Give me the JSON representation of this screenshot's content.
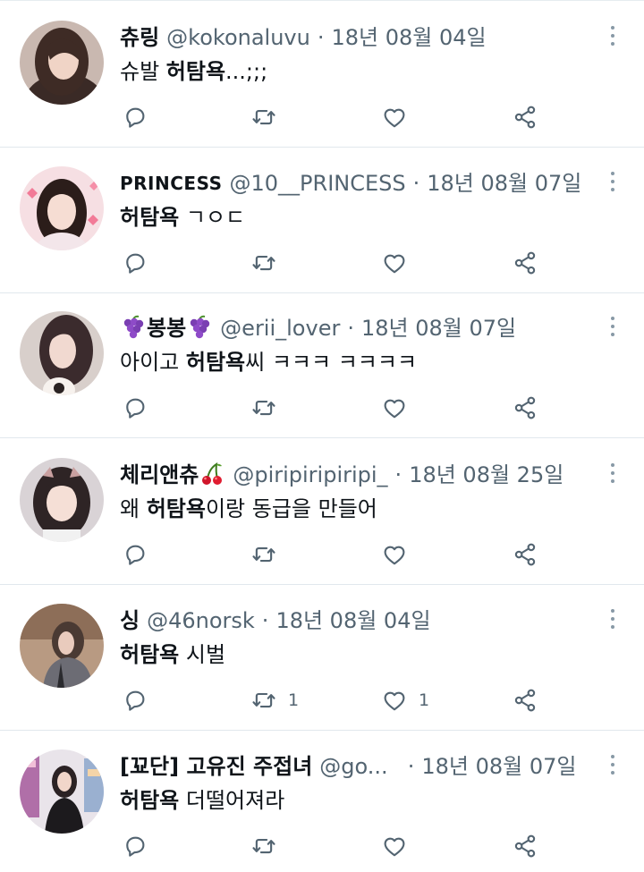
{
  "tweets": [
    {
      "name_pre": "츄링",
      "name_post": "",
      "name_emoji_pre": "",
      "name_emoji_post": "",
      "handle": "@kokonaluvu",
      "separator": "·",
      "date": "18년 08월 04일",
      "text_before": "슈발 ",
      "text_bold": "허탐욕",
      "text_after": "...;;;",
      "reply_count": "",
      "retweet_count": "",
      "like_count": ""
    },
    {
      "name_pre": "PRINCESS",
      "name_post": "",
      "name_emoji_pre": "",
      "name_emoji_post": "",
      "handle": "@10__PRINCESS",
      "separator": "·",
      "date": "18년 08월 07일",
      "text_before": "",
      "text_bold": "허탐욕",
      "text_after": " ㄱㅇㄷ",
      "reply_count": "",
      "retweet_count": "",
      "like_count": ""
    },
    {
      "name_pre": "",
      "name_post": "봉봉",
      "name_emoji_pre": "grapes",
      "name_emoji_post": "grapes",
      "handle": "@erii_lover",
      "separator": "·",
      "date": "18년 08월 07일",
      "text_before": "아이고 ",
      "text_bold": "허탐욕",
      "text_after": "씨 ㅋㅋㅋ ㅋㅋㅋㅋ",
      "reply_count": "",
      "retweet_count": "",
      "like_count": ""
    },
    {
      "name_pre": "체리앤츄",
      "name_post": "",
      "name_emoji_pre": "",
      "name_emoji_post": "cherries",
      "handle": "@piripiripiripi_",
      "separator": "·",
      "date": "18년 08월 25일",
      "text_before": "왜 ",
      "text_bold": "허탐욕",
      "text_after": "이랑 동급을 만들어",
      "reply_count": "",
      "retweet_count": "",
      "like_count": ""
    },
    {
      "name_pre": "싱",
      "name_post": "",
      "name_emoji_pre": "",
      "name_emoji_post": "",
      "handle": "@46norsk",
      "separator": "·",
      "date": "18년 08월 04일",
      "text_before": "",
      "text_bold": "허탐욕",
      "text_after": " 시벌",
      "reply_count": "",
      "retweet_count": "1",
      "like_count": "1"
    },
    {
      "name_pre": "[꾜단] 고유진 주접녀",
      "name_post": "",
      "name_emoji_pre": "",
      "name_emoji_post": "",
      "handle": "@go...",
      "separator": "·",
      "date": "18년 08월 07일",
      "text_before": "",
      "text_bold": "허탐욕",
      "text_after": " 더떨어져라",
      "reply_count": "",
      "retweet_count": "",
      "like_count": ""
    }
  ],
  "icons": {
    "reply": "reply-icon",
    "retweet": "retweet-icon",
    "like": "heart-icon",
    "share": "share-icon",
    "more": "more-vertical-icon"
  },
  "colors": {
    "text": "#0f1419",
    "secondary": "#536471",
    "divider": "#e1e8ed"
  }
}
